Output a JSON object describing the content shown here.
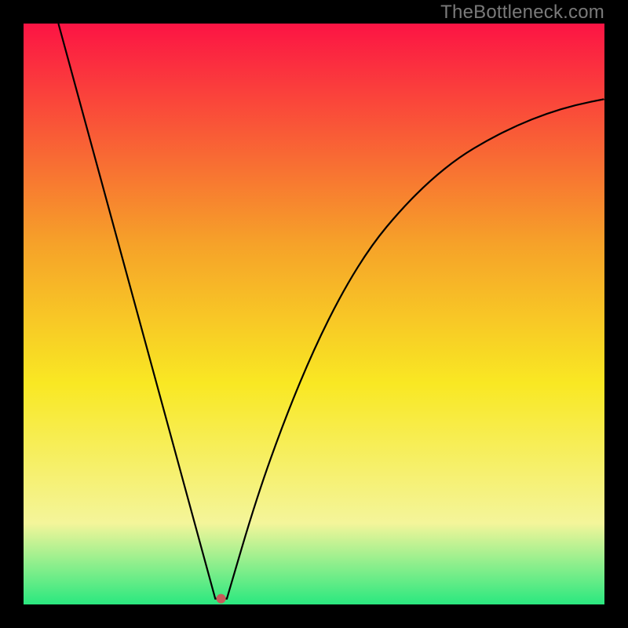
{
  "watermark": "TheBottleneck.com",
  "chart_data": {
    "type": "line",
    "title": "",
    "xlabel": "",
    "ylabel": "",
    "xlim": [
      0,
      100
    ],
    "ylim": [
      0,
      100
    ],
    "background_gradient": {
      "top": "#fc1444",
      "upper_mid": "#f6a229",
      "mid": "#f9e823",
      "lower_mid": "#f4f59a",
      "bottom": "#2ae87f"
    },
    "curve": {
      "description": "V-shaped bottleneck curve: steep linear descent from top-left to a minimum near x≈34, then a concave-up rise toward the right.",
      "min_at_x": 34,
      "left_segment": {
        "x_start": 6,
        "y_start": 100,
        "x_end": 33,
        "y_end": 1
      },
      "right_segment_samples": [
        {
          "x": 35,
          "y": 1
        },
        {
          "x": 40,
          "y": 18
        },
        {
          "x": 45,
          "y": 32
        },
        {
          "x": 50,
          "y": 44
        },
        {
          "x": 55,
          "y": 54
        },
        {
          "x": 60,
          "y": 62
        },
        {
          "x": 65,
          "y": 68
        },
        {
          "x": 70,
          "y": 73
        },
        {
          "x": 75,
          "y": 77
        },
        {
          "x": 80,
          "y": 80
        },
        {
          "x": 85,
          "y": 82.5
        },
        {
          "x": 90,
          "y": 84.5
        },
        {
          "x": 95,
          "y": 86
        },
        {
          "x": 100,
          "y": 87
        }
      ]
    },
    "marker": {
      "x": 34,
      "y": 1,
      "color": "#c75a5a",
      "r": 6
    }
  }
}
